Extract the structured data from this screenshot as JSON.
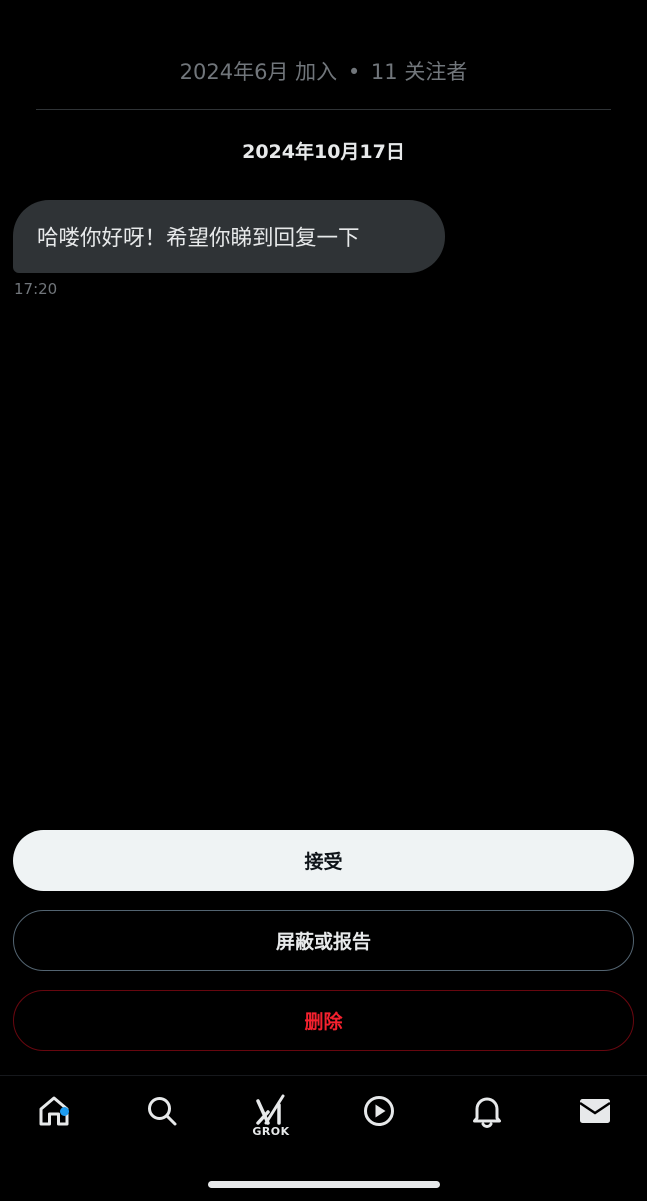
{
  "profile": {
    "joined": "2024年6月 加入",
    "separator": "•",
    "followers": "11 关注者"
  },
  "conversation": {
    "date_header": "2024年10月17日",
    "messages": [
      {
        "text": "哈喽你好呀！希望你睇到回复一下",
        "time": "17:20"
      }
    ]
  },
  "actions": {
    "accept_label": "接受",
    "block_report_label": "屏蔽或报告",
    "delete_label": "删除"
  },
  "nav": {
    "items": [
      {
        "icon": "home-icon",
        "has_notification": true
      },
      {
        "icon": "search-icon"
      },
      {
        "icon": "grok-icon",
        "label": "GROK"
      },
      {
        "icon": "play-icon"
      },
      {
        "icon": "bell-icon"
      },
      {
        "icon": "mail-icon"
      }
    ]
  },
  "colors": {
    "background": "#000000",
    "bubble": "#2f3336",
    "muted_text": "#71767b",
    "primary_text": "#e7e9ea",
    "accept_bg": "#eff3f4",
    "delete_text": "#f4212e",
    "delete_border": "#67070f",
    "notification_dot": "#1d9bf0"
  }
}
